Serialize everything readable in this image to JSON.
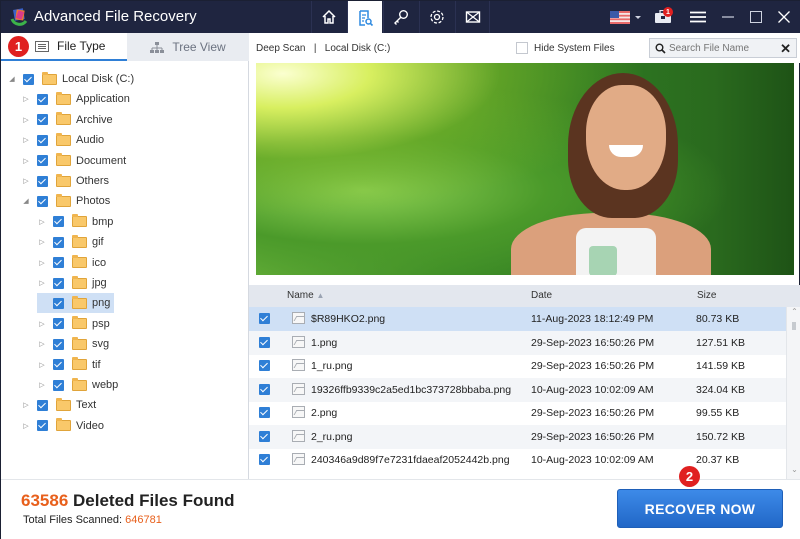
{
  "app": {
    "title": "Advanced File Recovery"
  },
  "nav_tabs": [
    {
      "name": "home",
      "icon": "home-icon",
      "active": false
    },
    {
      "name": "scan",
      "icon": "scan-results-icon",
      "active": true
    },
    {
      "name": "key",
      "icon": "key-icon",
      "active": false
    },
    {
      "name": "settings",
      "icon": "gear-icon",
      "active": false
    },
    {
      "name": "mail",
      "icon": "mail-icon",
      "active": false
    }
  ],
  "titlebar_right": {
    "language": "flag-us-icon",
    "notifications_count": "1",
    "menu": "hamburger-icon",
    "minimize": "minimize-icon",
    "maximize": "maximize-icon",
    "close": "close-icon"
  },
  "left_tabs": {
    "file_type": "File Type",
    "tree_view": "Tree View",
    "step_badge": "1"
  },
  "tree": [
    {
      "label": "Local Disk (C:)",
      "level": 0,
      "expander": "expanded",
      "checked": true
    },
    {
      "label": "Application",
      "level": 1,
      "expander": "collapsed",
      "checked": true
    },
    {
      "label": "Archive",
      "level": 1,
      "expander": "collapsed",
      "checked": true
    },
    {
      "label": "Audio",
      "level": 1,
      "expander": "collapsed",
      "checked": true
    },
    {
      "label": "Document",
      "level": 1,
      "expander": "collapsed",
      "checked": true
    },
    {
      "label": "Others",
      "level": 1,
      "expander": "collapsed",
      "checked": true
    },
    {
      "label": "Photos",
      "level": 1,
      "expander": "expanded",
      "checked": true
    },
    {
      "label": "bmp",
      "level": 2,
      "expander": "collapsed",
      "checked": true
    },
    {
      "label": "gif",
      "level": 2,
      "expander": "collapsed",
      "checked": true
    },
    {
      "label": "ico",
      "level": 2,
      "expander": "collapsed",
      "checked": true
    },
    {
      "label": "jpg",
      "level": 2,
      "expander": "collapsed",
      "checked": true
    },
    {
      "label": "png",
      "level": 2,
      "expander": "none",
      "checked": true,
      "selected": true
    },
    {
      "label": "psp",
      "level": 2,
      "expander": "collapsed",
      "checked": true
    },
    {
      "label": "svg",
      "level": 2,
      "expander": "collapsed",
      "checked": true
    },
    {
      "label": "tif",
      "level": 2,
      "expander": "collapsed",
      "checked": true
    },
    {
      "label": "webp",
      "level": 2,
      "expander": "collapsed",
      "checked": true
    },
    {
      "label": "Text",
      "level": 1,
      "expander": "collapsed",
      "checked": true
    },
    {
      "label": "Video",
      "level": 1,
      "expander": "collapsed",
      "checked": true
    }
  ],
  "right_header": {
    "scan_type": "Deep Scan",
    "separator": "|",
    "drive": "Local Disk (C:)",
    "hide_system_files_label": "Hide System Files",
    "hide_system_files_checked": false,
    "search_placeholder": "Search File Name",
    "search_value": ""
  },
  "preview": {
    "description": "Preview of selected image: smiling woman jogging with earphones in green park"
  },
  "table": {
    "columns": {
      "name": "Name",
      "date": "Date",
      "size": "Size",
      "sort": "name-ascending"
    },
    "rows": [
      {
        "name": "$R89HKO2.png",
        "date": "11-Aug-2023 18:12:49 PM",
        "size": "80.73 KB",
        "checked": true,
        "selected": true
      },
      {
        "name": "1.png",
        "date": "29-Sep-2023 16:50:26 PM",
        "size": "127.51 KB",
        "checked": true
      },
      {
        "name": "1_ru.png",
        "date": "29-Sep-2023 16:50:26 PM",
        "size": "141.59 KB",
        "checked": true
      },
      {
        "name": "19326ffb9339c2a5ed1bc373728bbaba.png",
        "date": "10-Aug-2023 10:02:09 AM",
        "size": "324.04 KB",
        "checked": true
      },
      {
        "name": "2.png",
        "date": "29-Sep-2023 16:50:26 PM",
        "size": "99.55 KB",
        "checked": true
      },
      {
        "name": "2_ru.png",
        "date": "29-Sep-2023 16:50:26 PM",
        "size": "150.72 KB",
        "checked": true
      },
      {
        "name": "240346a9d89f7e7231fdaeaf2052442b.png",
        "date": "10-Aug-2023 10:02:09 AM",
        "size": "20.37 KB",
        "checked": true
      }
    ]
  },
  "footer": {
    "deleted_count": "63586",
    "deleted_label": " Deleted Files Found",
    "scanned_label": "Total Files Scanned: ",
    "scanned_count": "646781",
    "recover_button": "RECOVER NOW",
    "step_badge": "2"
  },
  "colors": {
    "titlebar": "#1f2540",
    "accent_blue": "#2f7fd6",
    "orange": "#e8601c",
    "badge_red": "#e02020",
    "selection": "#cfe0f5"
  }
}
